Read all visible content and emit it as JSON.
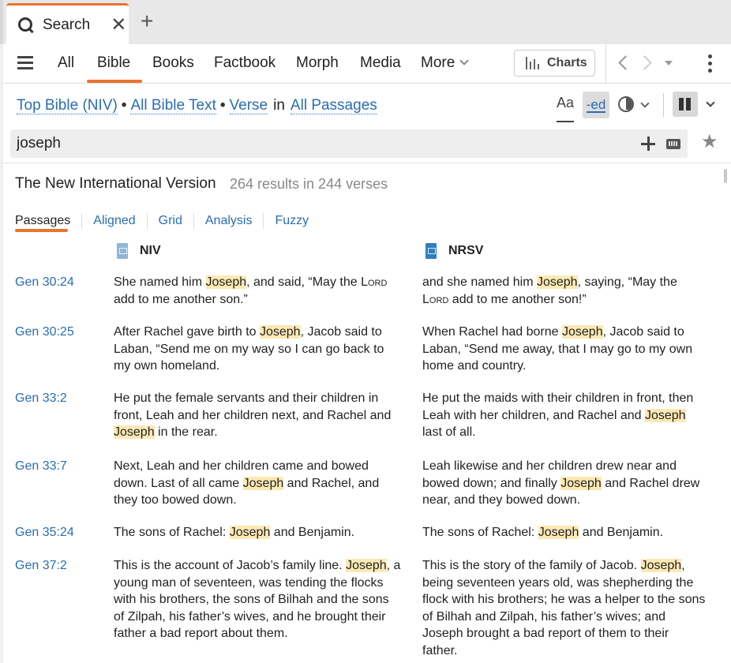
{
  "tab": {
    "title": "Search",
    "close": "✕",
    "new_tab": "+"
  },
  "nav": {
    "items": [
      "All",
      "Bible",
      "Books",
      "Factbook",
      "Morph",
      "Media",
      "More"
    ],
    "active": "Bible",
    "charts_label": "Charts"
  },
  "scope": {
    "resource": "Top Bible (NIV)",
    "text_scope": "All Bible Text",
    "unit": "Verse",
    "in_label": "in",
    "range": "All Passages"
  },
  "tools": {
    "font_label": "Aa",
    "ed_label": "-ed"
  },
  "search": {
    "query": "joseph",
    "placeholder": ""
  },
  "results": {
    "version_title": "The New International Version",
    "count": "264 results in 244 verses",
    "subtabs": [
      "Passages",
      "Aligned",
      "Grid",
      "Analysis",
      "Fuzzy"
    ],
    "active_subtab": "Passages",
    "columns": [
      "NIV",
      "NRSV"
    ],
    "highlight_term": "Joseph",
    "rows": [
      {
        "ref": "Gen 30:24",
        "niv": "She named him [Joseph], and said, “May the {Lord} add to me another son.”",
        "nrsv": "and she named him [Joseph], saying, “May the {Lord} add to me another son!”"
      },
      {
        "ref": "Gen 30:25",
        "niv": "After Rachel gave birth to [Joseph], Jacob said to Laban, “Send me on my way so I can go back to my own homeland.",
        "nrsv": "When Rachel had borne [Joseph], Jacob said to Laban, “Send me away, that I may go to my own home and country."
      },
      {
        "ref": "Gen 33:2",
        "niv": "He put the female servants and their children in front, Leah and her children next, and Rachel and [Joseph] in the rear.",
        "nrsv": "He put the maids with their children in front, then Leah with her children, and Rachel and [Joseph] last of all."
      },
      {
        "ref": "Gen 33:7",
        "niv": "Next, Leah and her children came and bowed down. Last of all came [Joseph] and Rachel, and they too bowed down.",
        "nrsv": "Leah likewise and her children drew near and bowed down; and finally [Joseph] and Rachel drew near, and they bowed down."
      },
      {
        "ref": "Gen 35:24",
        "niv": "The sons of Rachel: [Joseph] and Benjamin.",
        "nrsv": "The sons of Rachel: [Joseph] and Benjamin."
      },
      {
        "ref": "Gen 37:2",
        "niv": "This is the account of Jacob’s family line. [Joseph], a young man of seventeen, was tending the flocks with his brothers, the sons of Bilhah and the sons of Zilpah, his father’s wives, and he brought their father a bad report about them.",
        "nrsv": "This is the story of the family of Jacob. [Joseph], being seventeen years old, was shepherding the flock with his brothers; he was a helper to the sons of Bilhah and Zilpah, his father’s wives; and Joseph brought a bad report of them to their father."
      }
    ]
  }
}
